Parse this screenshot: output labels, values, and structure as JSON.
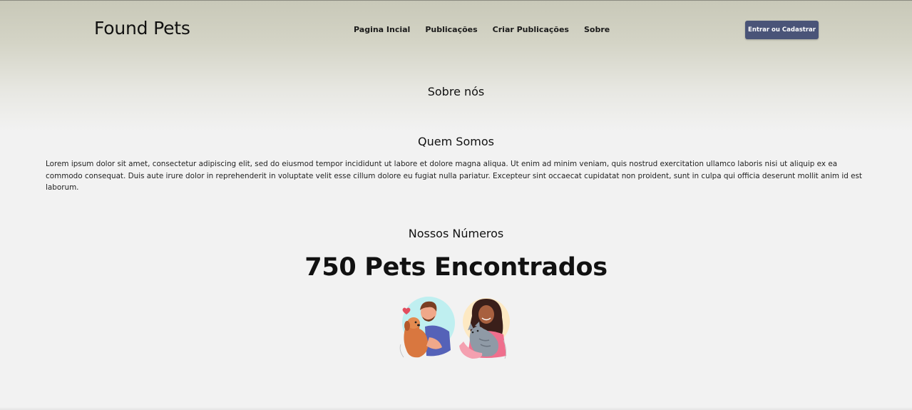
{
  "header": {
    "brand": "Found Pets",
    "nav": [
      "Pagina Incial",
      "Publicações",
      "Criar Publicações",
      "Sobre"
    ],
    "cta_label": "Entrar ou Cadastrar"
  },
  "about": {
    "title": "Sobre nós",
    "who_title": "Quem Somos",
    "who_text": "Lorem ipsum dolor sit amet, consectetur adipiscing elit, sed do eiusmod tempor incididunt ut labore et dolore magna aliqua. Ut enim ad minim veniam, quis nostrud exercitation ullamco laboris nisi ut aliquip ex ea commodo consequat. Duis aute irure dolor in reprehenderit in voluptate velit esse cillum dolore eu fugiat nulla pariatur. Excepteur sint occaecat cupidatat non proident, sunt in culpa qui officia deserunt mollit anim id est laborum."
  },
  "numbers": {
    "title": "Nossos Números",
    "stat": "750 Pets Encontrados"
  },
  "colors": {
    "cta_bg": "#4a5478",
    "header_bg": "#c8c8b8",
    "page_bg": "#f2f2f2"
  },
  "illustration": {
    "icons": [
      "man-holding-dog-illustration",
      "woman-holding-cat-illustration"
    ]
  }
}
